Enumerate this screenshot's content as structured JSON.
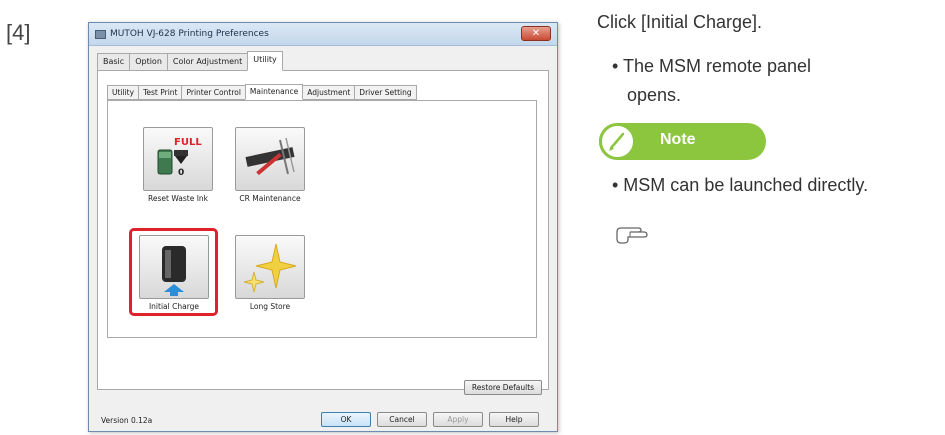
{
  "step": {
    "number": "[4]"
  },
  "window": {
    "title": "MUTOH VJ-628 Printing Preferences",
    "close_icon": "close-icon"
  },
  "outer_tabs": [
    {
      "label": "Basic",
      "active": false
    },
    {
      "label": "Option",
      "active": false
    },
    {
      "label": "Color Adjustment",
      "active": false
    },
    {
      "label": "Utility",
      "active": true
    }
  ],
  "inner_tabs": [
    {
      "label": "Utility",
      "active": false
    },
    {
      "label": "Test Print",
      "active": false
    },
    {
      "label": "Printer Control",
      "active": false
    },
    {
      "label": "Maintenance",
      "active": true
    },
    {
      "label": "Adjustment",
      "active": false
    },
    {
      "label": "Driver Setting",
      "active": false
    }
  ],
  "tiles": {
    "reset_waste_ink": {
      "label": "Reset Waste Ink",
      "badge": "FULL",
      "counter": "0"
    },
    "cr_maintenance": {
      "label": "CR Maintenance"
    },
    "initial_charge": {
      "label": "Initial Charge",
      "highlighted": true
    },
    "long_store": {
      "label": "Long Store"
    }
  },
  "footer": {
    "version": "Version 0.12a",
    "restore_defaults": "Restore Defaults",
    "ok": "OK",
    "cancel": "Cancel",
    "apply": "Apply",
    "help": "Help"
  },
  "instructions": {
    "main": "Click [Initial Charge].",
    "bullet1_line1": "• The MSM remote panel",
    "bullet1_line2": "opens.",
    "note_label": "Note",
    "note_bullet": "• MSM can be launched directly.",
    "reference_icon": "pointing-hand-icon"
  },
  "colors": {
    "highlight": "#e0202a",
    "note_green": "#8cc63f"
  }
}
